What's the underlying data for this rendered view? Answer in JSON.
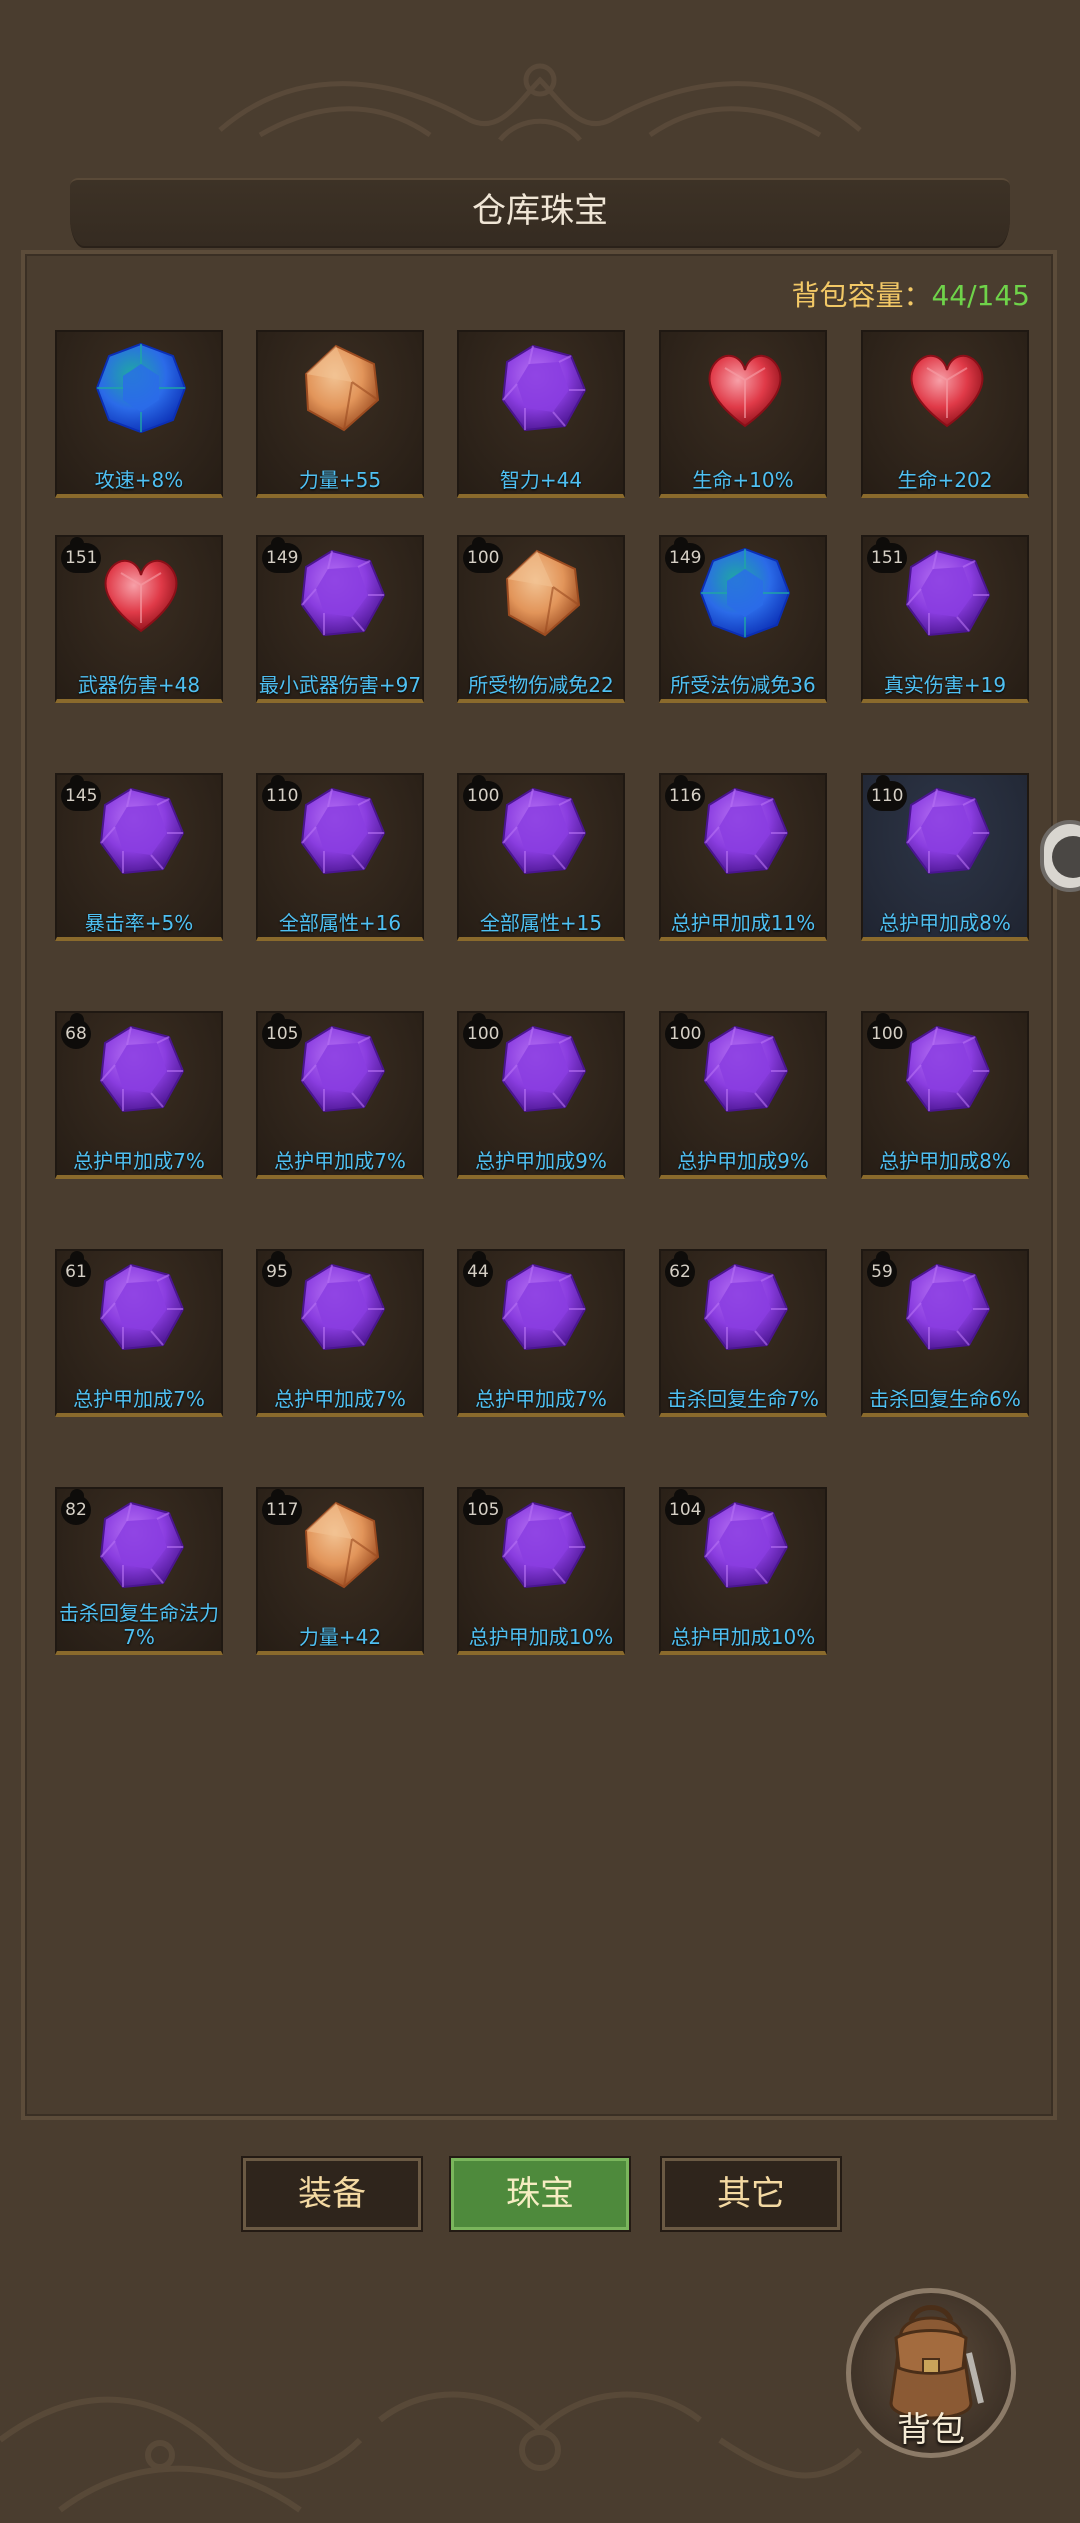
{
  "title": "仓库珠宝",
  "capacity": {
    "label": "背包容量：",
    "value": "44/145"
  },
  "tabs": [
    {
      "label": "装备",
      "active": false
    },
    {
      "label": "珠宝",
      "active": true
    },
    {
      "label": "其它",
      "active": false
    }
  ],
  "backpack_label": "背包",
  "colors": {
    "background": "#4a3d2f",
    "label_text": "#4fc0f2",
    "capacity_label": "#f2c866",
    "capacity_value": "#6fd34a",
    "tab_active": "#4e8a3c"
  },
  "items": [
    {
      "level": "",
      "gem": "blue",
      "label": "攻速+8%"
    },
    {
      "level": "",
      "gem": "orange",
      "label": "力量+55"
    },
    {
      "level": "",
      "gem": "purple",
      "label": "智力+44"
    },
    {
      "level": "",
      "gem": "red",
      "label": "生命+10%"
    },
    {
      "level": "",
      "gem": "red",
      "label": "生命+202"
    },
    {
      "level": "151",
      "gem": "red",
      "label": "武器伤害+48"
    },
    {
      "level": "149",
      "gem": "purple",
      "label": "最小武器伤害+97"
    },
    {
      "level": "100",
      "gem": "orange",
      "label": "所受物伤减免22"
    },
    {
      "level": "149",
      "gem": "blue",
      "label": "所受法伤减免36"
    },
    {
      "level": "151",
      "gem": "purple",
      "label": "真实伤害+19"
    },
    {
      "level": "145",
      "gem": "purple",
      "label": "暴击率+5%"
    },
    {
      "level": "110",
      "gem": "purple",
      "label": "全部属性+16"
    },
    {
      "level": "100",
      "gem": "purple",
      "label": "全部属性+15"
    },
    {
      "level": "116",
      "gem": "purple",
      "label": "总护甲加成11%"
    },
    {
      "level": "110",
      "gem": "purple",
      "label": "总护甲加成8%",
      "highlight": true
    },
    {
      "level": "68",
      "gem": "purple",
      "label": "总护甲加成7%"
    },
    {
      "level": "105",
      "gem": "purple",
      "label": "总护甲加成7%"
    },
    {
      "level": "100",
      "gem": "purple",
      "label": "总护甲加成9%"
    },
    {
      "level": "100",
      "gem": "purple",
      "label": "总护甲加成9%"
    },
    {
      "level": "100",
      "gem": "purple",
      "label": "总护甲加成8%"
    },
    {
      "level": "61",
      "gem": "purple",
      "label": "总护甲加成7%"
    },
    {
      "level": "95",
      "gem": "purple",
      "label": "总护甲加成7%"
    },
    {
      "level": "44",
      "gem": "purple",
      "label": "总护甲加成7%"
    },
    {
      "level": "62",
      "gem": "purple",
      "label": "击杀回复生命7%"
    },
    {
      "level": "59",
      "gem": "purple",
      "label": "击杀回复生命6%"
    },
    {
      "level": "82",
      "gem": "purple",
      "label": "击杀回复生命法力7%"
    },
    {
      "level": "117",
      "gem": "orange",
      "label": "力量+42"
    },
    {
      "level": "105",
      "gem": "purple",
      "label": "总护甲加成10%"
    },
    {
      "level": "104",
      "gem": "purple",
      "label": "总护甲加成10%"
    }
  ]
}
